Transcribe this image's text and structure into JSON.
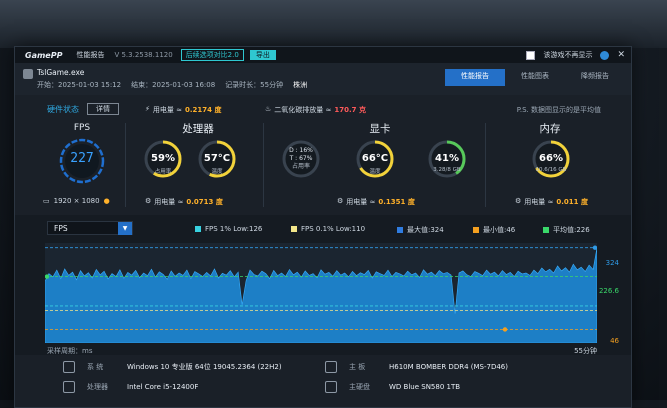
{
  "titlebar": {
    "logo": "GamePP",
    "title": "性能报告",
    "version": "V 5.3.2538.1120",
    "btn_outline": "后续选项对比2.0",
    "btn_fill": "导出",
    "checkbox_label": "该游戏不再显示",
    "close": "✕"
  },
  "game": {
    "name": "TslGame.exe",
    "start": "开始：2025-01-03 15:12",
    "end": "结束：2025-01-03 16:08",
    "duration": "记录时长：55分钟",
    "location": "株洲"
  },
  "tabs": [
    {
      "label": "性能报告",
      "active": true
    },
    {
      "label": "性能图表",
      "active": false
    },
    {
      "label": "降频报告",
      "active": false
    }
  ],
  "hardware": {
    "status_label": "硬件状态",
    "detail_button": "详情",
    "power_total_prefix": "用电量 ≈",
    "power_total": "0.2174 度",
    "co2_prefix": "二氧化碳排放量 ≈",
    "co2": "170.7 克",
    "ps": "P.S. 数据图显示的是平均值",
    "fps_title": "FPS",
    "fps_value": "227",
    "resolution": "1920 × 1080",
    "sections": [
      {
        "title": "处理器",
        "power_prefix": "用电量 ≈",
        "power": "0.0713 度",
        "rings": [
          {
            "value": "59%",
            "sub": "占用率",
            "fill": 0.59,
            "color": "#f2d23a"
          },
          {
            "value": "57°C",
            "sub": "温度",
            "fill": 0.57,
            "color": "#f2d23a"
          }
        ]
      },
      {
        "title": "显卡",
        "power_prefix": "用电量 ≈",
        "power": "0.1351 度",
        "text_block": [
          "D : 16%",
          "T : 67%",
          "占用率"
        ],
        "rings": [
          {
            "value": "66°C",
            "sub": "温度",
            "fill": 0.66,
            "color": "#f2d23a"
          },
          {
            "value": "41%",
            "sub": "3.28/8 GB",
            "fill": 0.41,
            "color": "#57c95a"
          }
        ]
      },
      {
        "title": "内存",
        "power_prefix": "用电量 ≈",
        "power": "0.011 度",
        "rings": [
          {
            "value": "66%",
            "sub": "10.6/16 GB",
            "fill": 0.66,
            "color": "#f2d23a"
          }
        ]
      }
    ]
  },
  "chart": {
    "selector": "FPS",
    "legend": [
      {
        "label": "FPS 1% Low:126",
        "color": "#38d2e0"
      },
      {
        "label": "FPS 0.1% Low:110",
        "color": "#f2e68a"
      },
      {
        "label": "最大值:324",
        "color": "#2f7ce0"
      },
      {
        "label": "最小值:46",
        "color": "#f4a020"
      },
      {
        "label": "平均值:226",
        "color": "#3ad86a"
      }
    ],
    "y_ticks": [
      {
        "label": "324",
        "color": "#2f9ae6"
      },
      {
        "label": "226.6",
        "color": "#3ad86a"
      },
      {
        "label": "46",
        "color": "#f4a020"
      }
    ],
    "x_left": "采样周期：ms",
    "x_right": "55分钟"
  },
  "chart_data": {
    "type": "area",
    "title": "",
    "xlabel": "",
    "ylabel": "FPS",
    "ylim": [
      0,
      340
    ],
    "series": [
      {
        "name": "FPS",
        "values": [
          210,
          236,
          225,
          248,
          219,
          252,
          230,
          241,
          215,
          246,
          228,
          239,
          221,
          250,
          232,
          244,
          218,
          236,
          226,
          249,
          220,
          240,
          231,
          247,
          222,
          238,
          229,
          251,
          224,
          242,
          233,
          217,
          245,
          227,
          238,
          230,
          248,
          219,
          243,
          235,
          226,
          240,
          228,
          252,
          221,
          237,
          231,
          246,
          225,
          241,
          130,
          212,
          248,
          233,
          228,
          244,
          236,
          219,
          247,
          229,
          238,
          226,
          250,
          232,
          241,
          224,
          245,
          230,
          236,
          222,
          249,
          234,
          240,
          227,
          246,
          231,
          238,
          225,
          243,
          229,
          239,
          233,
          247,
          221,
          242,
          236,
          230,
          248,
          226,
          240,
          235,
          228,
          244,
          232,
          238,
          223,
          249,
          234,
          241,
          229,
          246,
          236,
          240,
          231,
          100,
          238,
          245,
          232,
          226,
          243,
          237,
          229,
          248,
          234,
          241,
          228,
          246,
          233,
          240,
          226,
          244,
          235,
          238,
          230,
          248,
          236,
          255,
          242,
          251,
          238,
          262,
          245,
          256,
          241,
          268,
          249,
          258,
          243,
          265,
          250,
          324
        ]
      }
    ],
    "annotations": {
      "fps_1pct_low": 126,
      "fps_0_1pct_low": 110,
      "max": 324,
      "min": 46,
      "avg": 226
    }
  },
  "system": [
    {
      "key": "系 统",
      "value": "Windows 10 专业版 64位 19045.2364 (22H2)",
      "icon": "windows-icon"
    },
    {
      "key": "主 板",
      "value": "H610M BOMBER DDR4 (MS-7D46)",
      "icon": "motherboard-icon"
    },
    {
      "key": "处理器",
      "value": "Intel Core i5-12400F",
      "icon": "cpu-icon"
    },
    {
      "key": "主硬盘",
      "value": "WD Blue SN580 1TB",
      "icon": "disk-icon"
    }
  ]
}
